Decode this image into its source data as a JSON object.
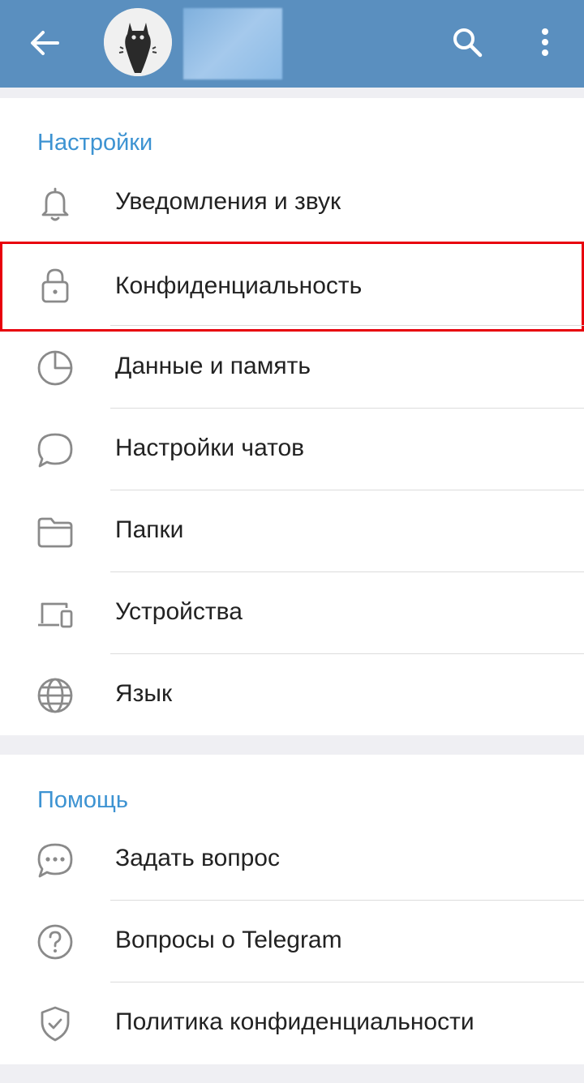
{
  "header": {
    "back_icon": "arrow-left-icon",
    "search_icon": "search-icon",
    "more_icon": "more-vertical-icon",
    "color": "#5a8fbf"
  },
  "settings": {
    "title": "Настройки",
    "items": [
      {
        "label": "Уведомления и звук",
        "icon": "bell-icon"
      },
      {
        "label": "Конфиденциальность",
        "icon": "lock-icon",
        "highlighted": true
      },
      {
        "label": "Данные и память",
        "icon": "pie-chart-icon"
      },
      {
        "label": "Настройки чатов",
        "icon": "chat-bubble-icon"
      },
      {
        "label": "Папки",
        "icon": "folder-icon"
      },
      {
        "label": "Устройства",
        "icon": "devices-icon"
      },
      {
        "label": "Язык",
        "icon": "globe-icon"
      }
    ]
  },
  "help": {
    "title": "Помощь",
    "items": [
      {
        "label": "Задать вопрос",
        "icon": "chat-dots-icon"
      },
      {
        "label": "Вопросы о Telegram",
        "icon": "question-circle-icon"
      },
      {
        "label": "Политика конфиденциальности",
        "icon": "shield-check-icon"
      }
    ]
  },
  "colors": {
    "accent": "#3d93d2",
    "highlight_border": "#e8000c",
    "icon": "#8a8a8a"
  }
}
